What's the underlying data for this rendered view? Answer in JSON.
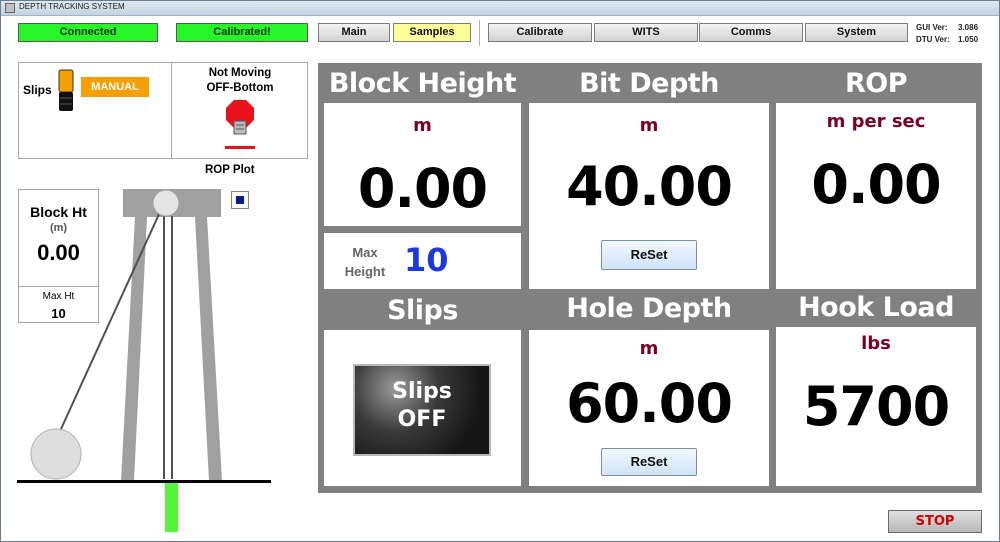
{
  "window": {
    "title": "DEPTH TRACKING SYSTEM"
  },
  "status": {
    "connection": "Connected",
    "calibration": "Calibrated!",
    "color_ok": "#26f526"
  },
  "nav": {
    "main": "Main",
    "samples": "Samples",
    "calibrate": "Calibrate",
    "wits": "WITS",
    "comms": "Comms",
    "system": "System",
    "active": "Samples"
  },
  "versions": {
    "gui_label": "GUI Ver:",
    "gui_value": "3.086",
    "dtu_label": "DTU Ver:",
    "dtu_value": "1.050"
  },
  "slips_status": {
    "label": "Slips",
    "mode": "MANUAL",
    "motion_line1": "Not Moving",
    "motion_line2": "OFF-Bottom",
    "mode_color": "#f5a000"
  },
  "rop_plot": {
    "label": "ROP Plot"
  },
  "block_gauge": {
    "title": "Block Ht",
    "unit": "(m)",
    "value": "0.00",
    "max_label": "Max Ht",
    "max_value": "10"
  },
  "block_height": {
    "title": "Block Height",
    "unit": "m",
    "value": "0.00"
  },
  "max_height": {
    "label_line1": "Max",
    "label_line2": "Height",
    "value": "10"
  },
  "bit_depth": {
    "title": "Bit Depth",
    "unit": "m",
    "value": "40.00",
    "reset": "ReSet"
  },
  "rop": {
    "title": "ROP",
    "unit": "m per sec",
    "value": "0.00"
  },
  "slips": {
    "title": "Slips",
    "indicator_line1": "Slips",
    "indicator_line2": "OFF"
  },
  "hole_depth": {
    "title": "Hole Depth",
    "unit": "m",
    "value": "60.00",
    "reset": "ReSet"
  },
  "hook_load": {
    "title": "Hook Load",
    "unit": "lbs",
    "value": "5700"
  },
  "stop": {
    "label": "STOP",
    "color": "#d00000"
  }
}
